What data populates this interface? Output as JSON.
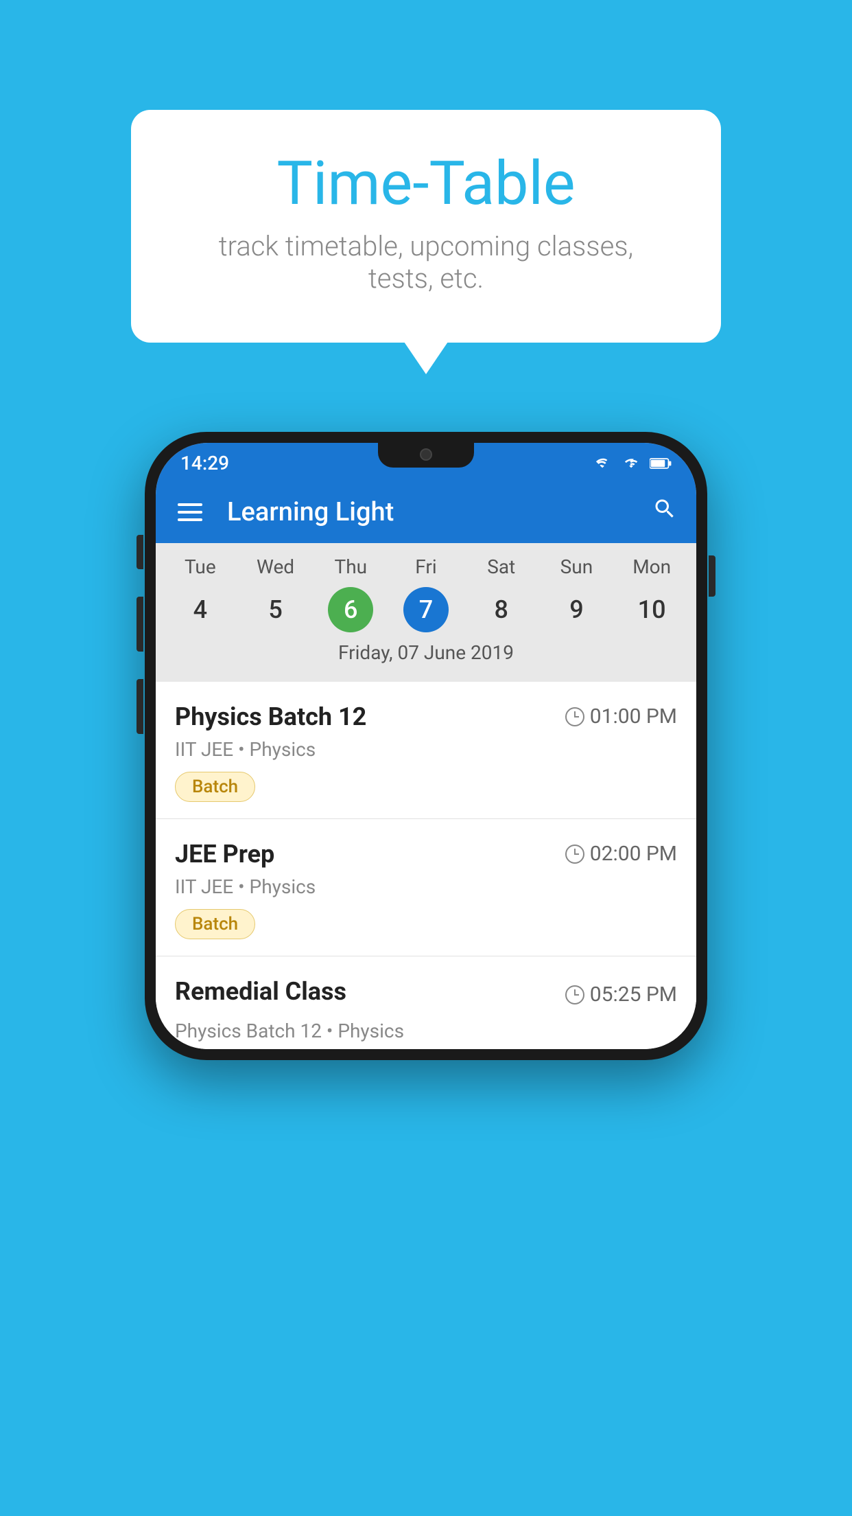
{
  "background_color": "#29b6e8",
  "bubble": {
    "title": "Time-Table",
    "subtitle": "track timetable, upcoming classes, tests, etc."
  },
  "phone": {
    "status_bar": {
      "time": "14:29"
    },
    "app_bar": {
      "title": "Learning Light",
      "menu_icon": "hamburger-icon",
      "search_icon": "search-icon"
    },
    "calendar": {
      "days": [
        {
          "label": "Tue",
          "num": "4"
        },
        {
          "label": "Wed",
          "num": "5"
        },
        {
          "label": "Thu",
          "num": "6",
          "state": "today"
        },
        {
          "label": "Fri",
          "num": "7",
          "state": "selected"
        },
        {
          "label": "Sat",
          "num": "8"
        },
        {
          "label": "Sun",
          "num": "9"
        },
        {
          "label": "Mon",
          "num": "10"
        }
      ],
      "selected_date": "Friday, 07 June 2019"
    },
    "schedule": [
      {
        "name": "Physics Batch 12",
        "time": "01:00 PM",
        "meta": "IIT JEE • Physics",
        "tag": "Batch"
      },
      {
        "name": "JEE Prep",
        "time": "02:00 PM",
        "meta": "IIT JEE • Physics",
        "tag": "Batch"
      },
      {
        "name": "Remedial Class",
        "time": "05:25 PM",
        "meta": "Physics Batch 12 • Physics",
        "tag": null
      }
    ]
  }
}
